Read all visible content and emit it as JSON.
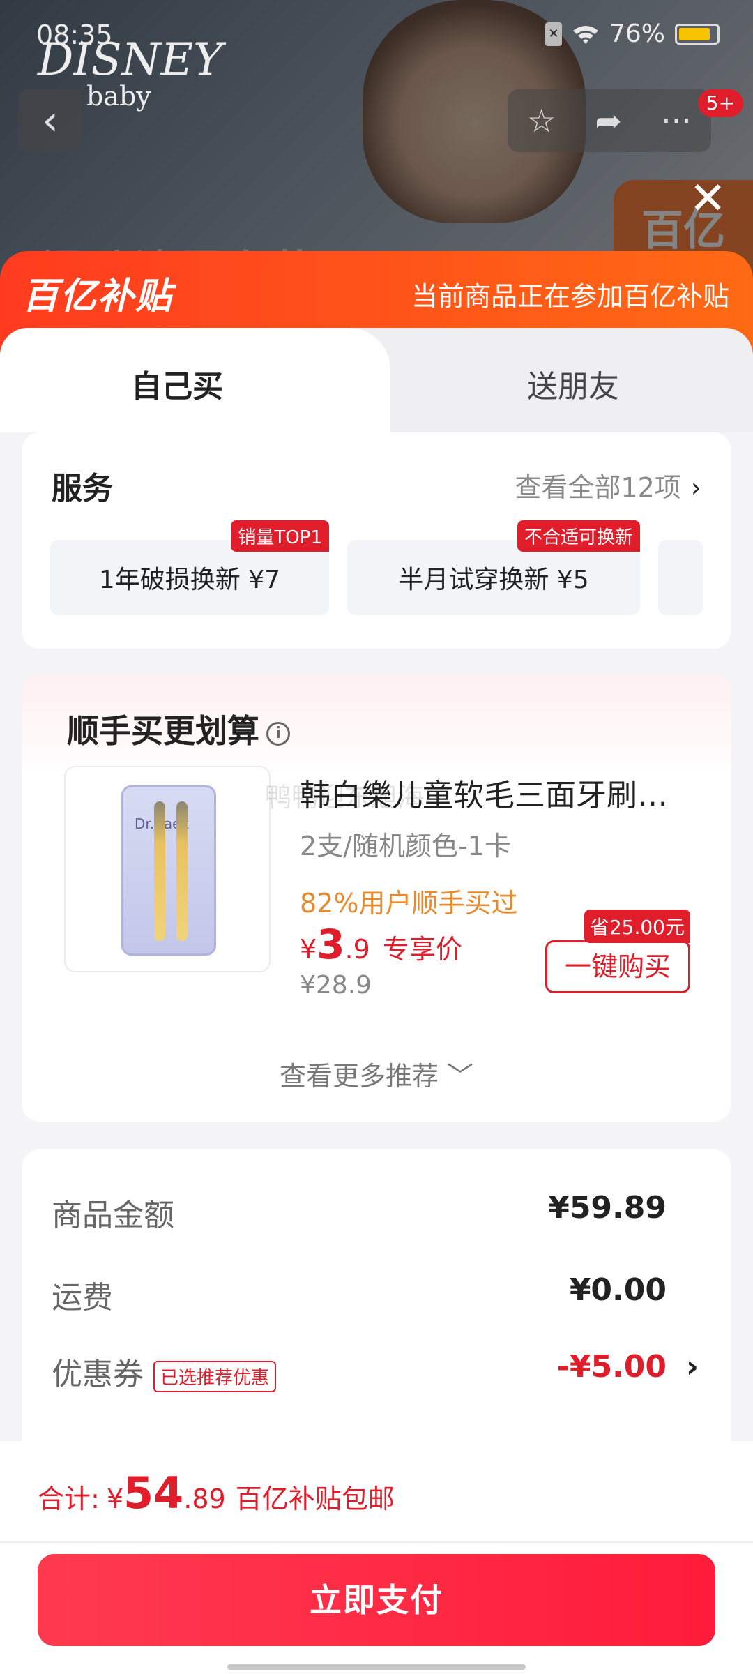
{
  "status_bar": {
    "time": "08:35",
    "battery": "76%",
    "sim_icon": "sim-icon",
    "wifi_icon": "wifi-icon"
  },
  "background_page": {
    "brand_line1": "DISNEY",
    "brand_line2": "baby",
    "title_partial": "浸动清雪套装",
    "corner_text": "百亿",
    "cart_badge": "5+"
  },
  "banner": {
    "logo": "百亿补贴",
    "text": "当前商品正在参加百亿补贴"
  },
  "tabs": [
    {
      "label": "自己买",
      "active": true
    },
    {
      "label": "送朋友",
      "active": false
    }
  ],
  "service": {
    "title": "服务",
    "view_all": "查看全部12项",
    "chips": [
      {
        "label": "1年破损换新 ¥7",
        "tag": "销量TOP1"
      },
      {
        "label": "半月试穿换新 ¥5",
        "tag": "不合适可换新"
      }
    ]
  },
  "recommend": {
    "title": "顺手买更划算",
    "product": {
      "name": "韩白樂儿童软毛三面牙刷…",
      "spec": "2支/随机颜色-1卡",
      "social": "82%用户顺手买过",
      "price_currency": "¥",
      "price_int": "3",
      "price_dec": ".9",
      "price_label": "专享价",
      "original_price": "¥28.9",
      "save_tag": "省25.00元",
      "buy_label": "一键购买",
      "pack_brand": "Dr.Baek"
    },
    "more": "查看更多推荐"
  },
  "watermark": "鸭鸭迎东旭海",
  "summary": {
    "rows": [
      {
        "label": "商品金额",
        "value": "¥59.89"
      },
      {
        "label": "运费",
        "value": "¥0.00"
      },
      {
        "label": "优惠券",
        "tag": "已选推荐优惠",
        "value": "-¥5.00"
      }
    ]
  },
  "footer": {
    "total_label": "合计:",
    "currency": "¥",
    "total_int": "54",
    "total_dec": ".89",
    "shipping_note": "百亿补贴包邮",
    "pay_label": "立即支付"
  },
  "colors": {
    "accent_red": "#e01e2b",
    "banner_orange": "#ff4a1a",
    "social_orange": "#e88a2e"
  }
}
